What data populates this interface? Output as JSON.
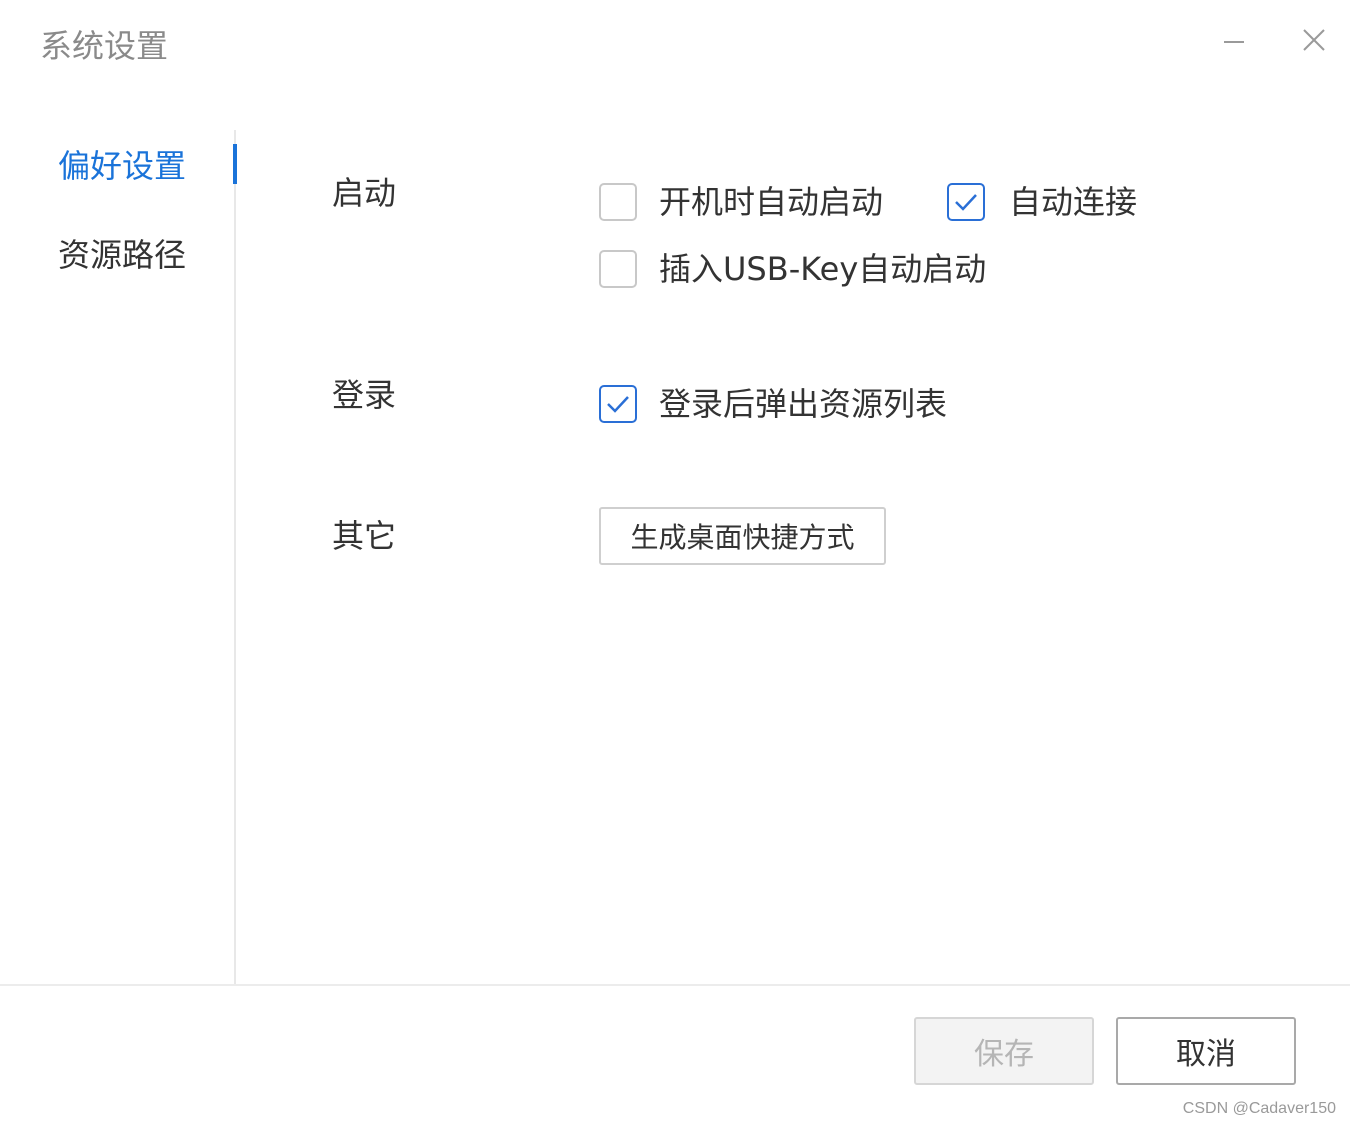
{
  "window": {
    "title": "系统设置",
    "minimize_icon": "minimize-icon",
    "close_icon": "close-icon"
  },
  "sidebar": {
    "items": [
      {
        "label": "偏好设置",
        "active": true
      },
      {
        "label": "资源路径",
        "active": false
      }
    ],
    "accent_color": "#1a73d9"
  },
  "sections": {
    "startup": {
      "label": "启动",
      "options": [
        {
          "label": "开机时自动启动",
          "checked": false
        },
        {
          "label": "自动连接",
          "checked": true
        },
        {
          "label": "插入USB-Key自动启动",
          "checked": false
        }
      ]
    },
    "login": {
      "label": "登录",
      "options": [
        {
          "label": "登录后弹出资源列表",
          "checked": true
        }
      ]
    },
    "other": {
      "label": "其它",
      "button_label": "生成桌面快捷方式"
    }
  },
  "footer": {
    "save_label": "保存",
    "save_enabled": false,
    "cancel_label": "取消"
  },
  "watermark": "CSDN @Cadaver150",
  "colors": {
    "checkbox_checked": "#2a6fd6",
    "checkbox_unchecked": "#c8c8c8"
  }
}
